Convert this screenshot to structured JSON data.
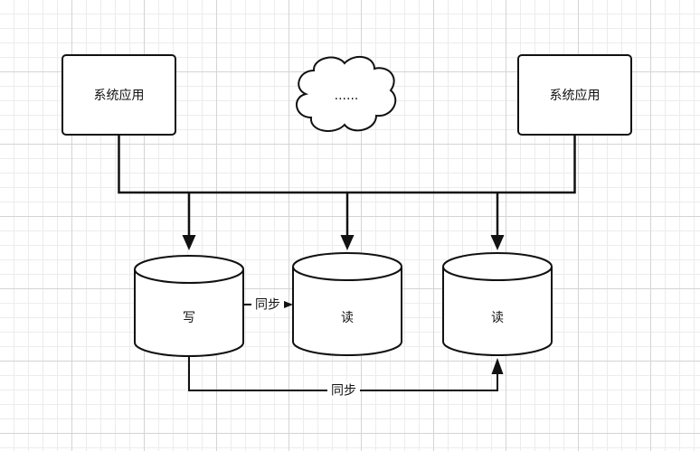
{
  "diagram": {
    "nodes": {
      "app_left": {
        "label": "系统应用"
      },
      "app_right": {
        "label": "系统应用"
      },
      "cloud": {
        "label": "......"
      },
      "db_write": {
        "label": "写"
      },
      "db_read_1": {
        "label": "读"
      },
      "db_read_2": {
        "label": "读"
      }
    },
    "edges": {
      "sync_write_to_read1": {
        "label": "同步"
      },
      "sync_write_to_read2": {
        "label": "同步"
      }
    }
  }
}
